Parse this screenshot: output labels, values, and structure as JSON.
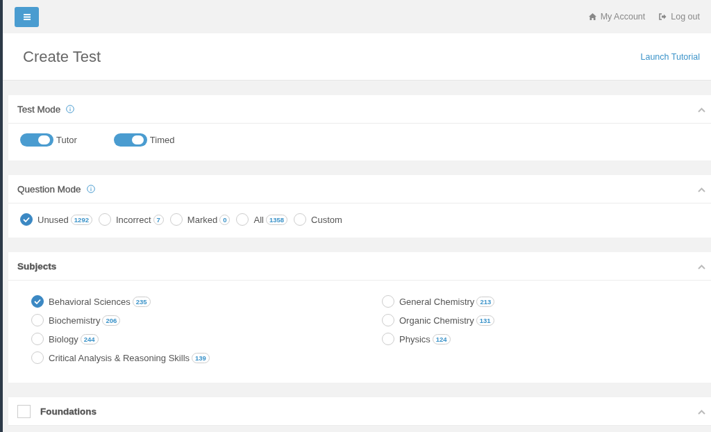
{
  "topbar": {
    "account_link": "My Account",
    "logout_link": "Log out"
  },
  "header": {
    "title": "Create Test",
    "tutorial_link": "Launch Tutorial"
  },
  "panels": [
    {
      "kind": "toggles",
      "title": "Test Mode",
      "info": true,
      "expanded": true,
      "toggles": [
        {
          "label": "Tutor",
          "on": true
        },
        {
          "label": "Timed",
          "on": true
        }
      ]
    },
    {
      "kind": "radios",
      "title": "Question Mode",
      "info": true,
      "expanded": true,
      "options": [
        {
          "label": "Unused",
          "count": "1292",
          "selected": true
        },
        {
          "label": "Incorrect",
          "count": "7",
          "selected": false
        },
        {
          "label": "Marked",
          "count": "0",
          "selected": false
        },
        {
          "label": "All",
          "count": "1358",
          "selected": false
        },
        {
          "label": "Custom",
          "selected": false
        }
      ]
    },
    {
      "kind": "subjects",
      "title": "Subjects",
      "info": false,
      "expanded": true,
      "columns": [
        [
          {
            "label": "Behavioral Sciences",
            "count": "235",
            "checked": true
          },
          {
            "label": "Biochemistry",
            "count": "206",
            "checked": false
          },
          {
            "label": "Biology",
            "count": "244",
            "checked": false
          },
          {
            "label": "Critical Analysis & Reasoning Skills",
            "count": "139",
            "checked": false
          }
        ],
        [
          {
            "label": "General Chemistry",
            "count": "213",
            "checked": false
          },
          {
            "label": "Organic Chemistry",
            "count": "131",
            "checked": false
          },
          {
            "label": "Physics",
            "count": "124",
            "checked": false
          }
        ]
      ]
    },
    {
      "kind": "group",
      "title": "Foundations",
      "info": false,
      "expanded": true,
      "checked": false
    }
  ]
}
